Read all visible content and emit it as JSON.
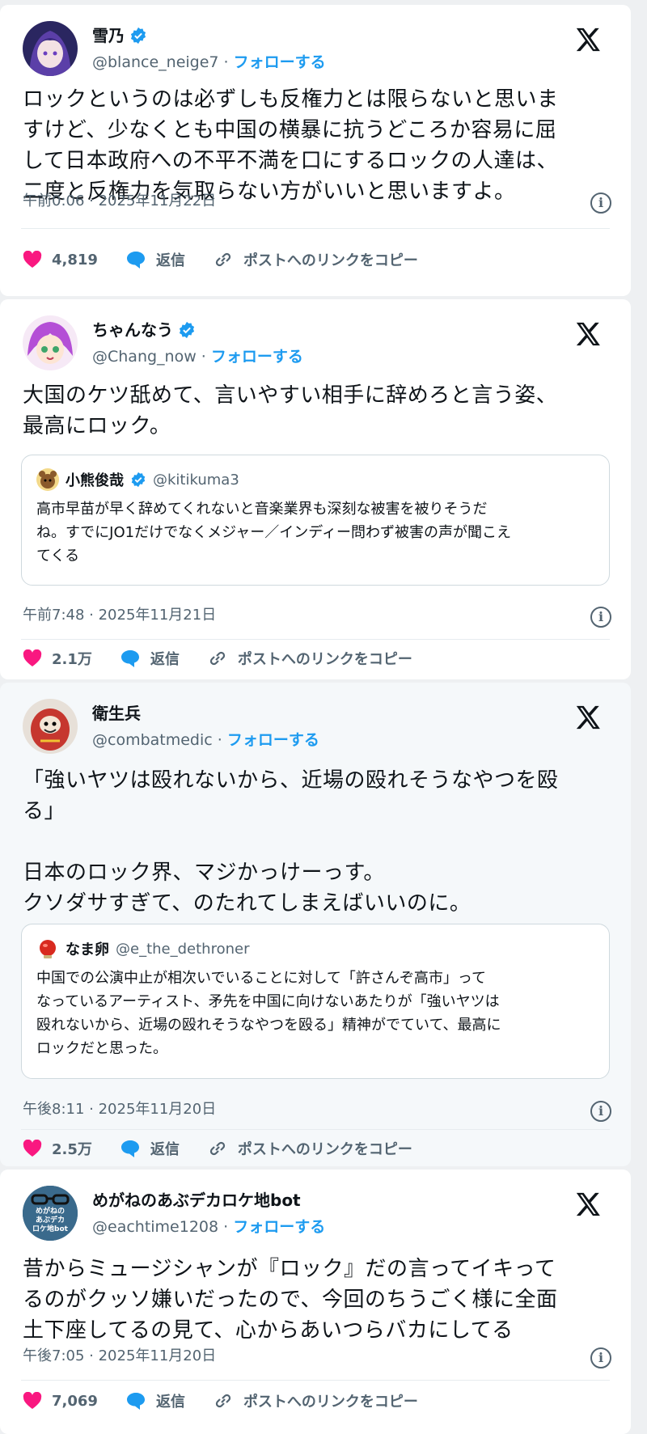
{
  "brand": {
    "follow_color": "#1d9bf0",
    "like_color": "#f91880",
    "reply_color": "#1d9bf0"
  },
  "posts": [
    {
      "name": "雪乃",
      "handle": "@blance_neige7 · ",
      "follow": "フォローする",
      "text": "ロックというのは必ずしも反権力とは限らないと思いま\nすけど、少なくとも中国の横暴に抗うどころか容易に屈\nして日本政府への不平不満を口にするロックの人達は、\n二度と反権力を気取らない方がいいと思いますよ。",
      "time": "午前0:06 · 2025年11月22日",
      "likes": "4,819",
      "reply": "返信",
      "copy": "ポストへのリンクをコピー"
    },
    {
      "name": "ちゃんなう",
      "handle": "@Chang_now · ",
      "follow": "フォローする",
      "text": "大国のケツ舐めて、言いやすい相手に辞めろと言う姿、\n最高にロック。",
      "quote": {
        "name": "小熊俊哉",
        "handle": "@kitikuma3",
        "text": "高市早苗が早く辞めてくれないと音楽業界も深刻な被害を被りそうだ\nね。すでにJO1だけでなくメジャー／インディー問わず被害の声が聞こえ\nてくる"
      },
      "time": "午前7:48 · 2025年11月21日",
      "likes": "2.1万",
      "reply": "返信",
      "copy": "ポストへのリンクをコピー"
    },
    {
      "name": "衛生兵",
      "handle": "@combatmedic · ",
      "follow": "フォローする",
      "text": "「強いヤツは殴れないから、近場の殴れそうなやつを殴\nる」\n\n日本のロック界、マジかっけーっす。\nクソダサすぎて、のたれてしまえばいいのに。",
      "quote": {
        "name": "なま卵",
        "handle": "@e_the_dethroner",
        "text": "中国での公演中止が相次いでいることに対して「許さんぞ高市」って\nなっているアーティスト、矛先を中国に向けないあたりが「強いヤツは\n殴れないから、近場の殴れそうなやつを殴る」精神がでていて、最高に\nロックだと思った。"
      },
      "time": "午後8:11 · 2025年11月20日",
      "likes": "2.5万",
      "reply": "返信",
      "copy": "ポストへのリンクをコピー"
    },
    {
      "name": "めがねのあぶデカロケ地bot",
      "handle": "@eachtime1208 · ",
      "follow": "フォローする",
      "avatar_text": "めがねの\nあぶデカ\nロケ地bot",
      "text": "昔からミュージシャンが『ロック』だの言ってイキって\nるのがクッソ嫌いだったので、今回のちうごく様に全面\n土下座してるの見て、心からあいつらバカにしてる",
      "time": "午後7:05 · 2025年11月20日",
      "likes": "7,069",
      "reply": "返信",
      "copy": "ポストへのリンクをコピー"
    }
  ]
}
